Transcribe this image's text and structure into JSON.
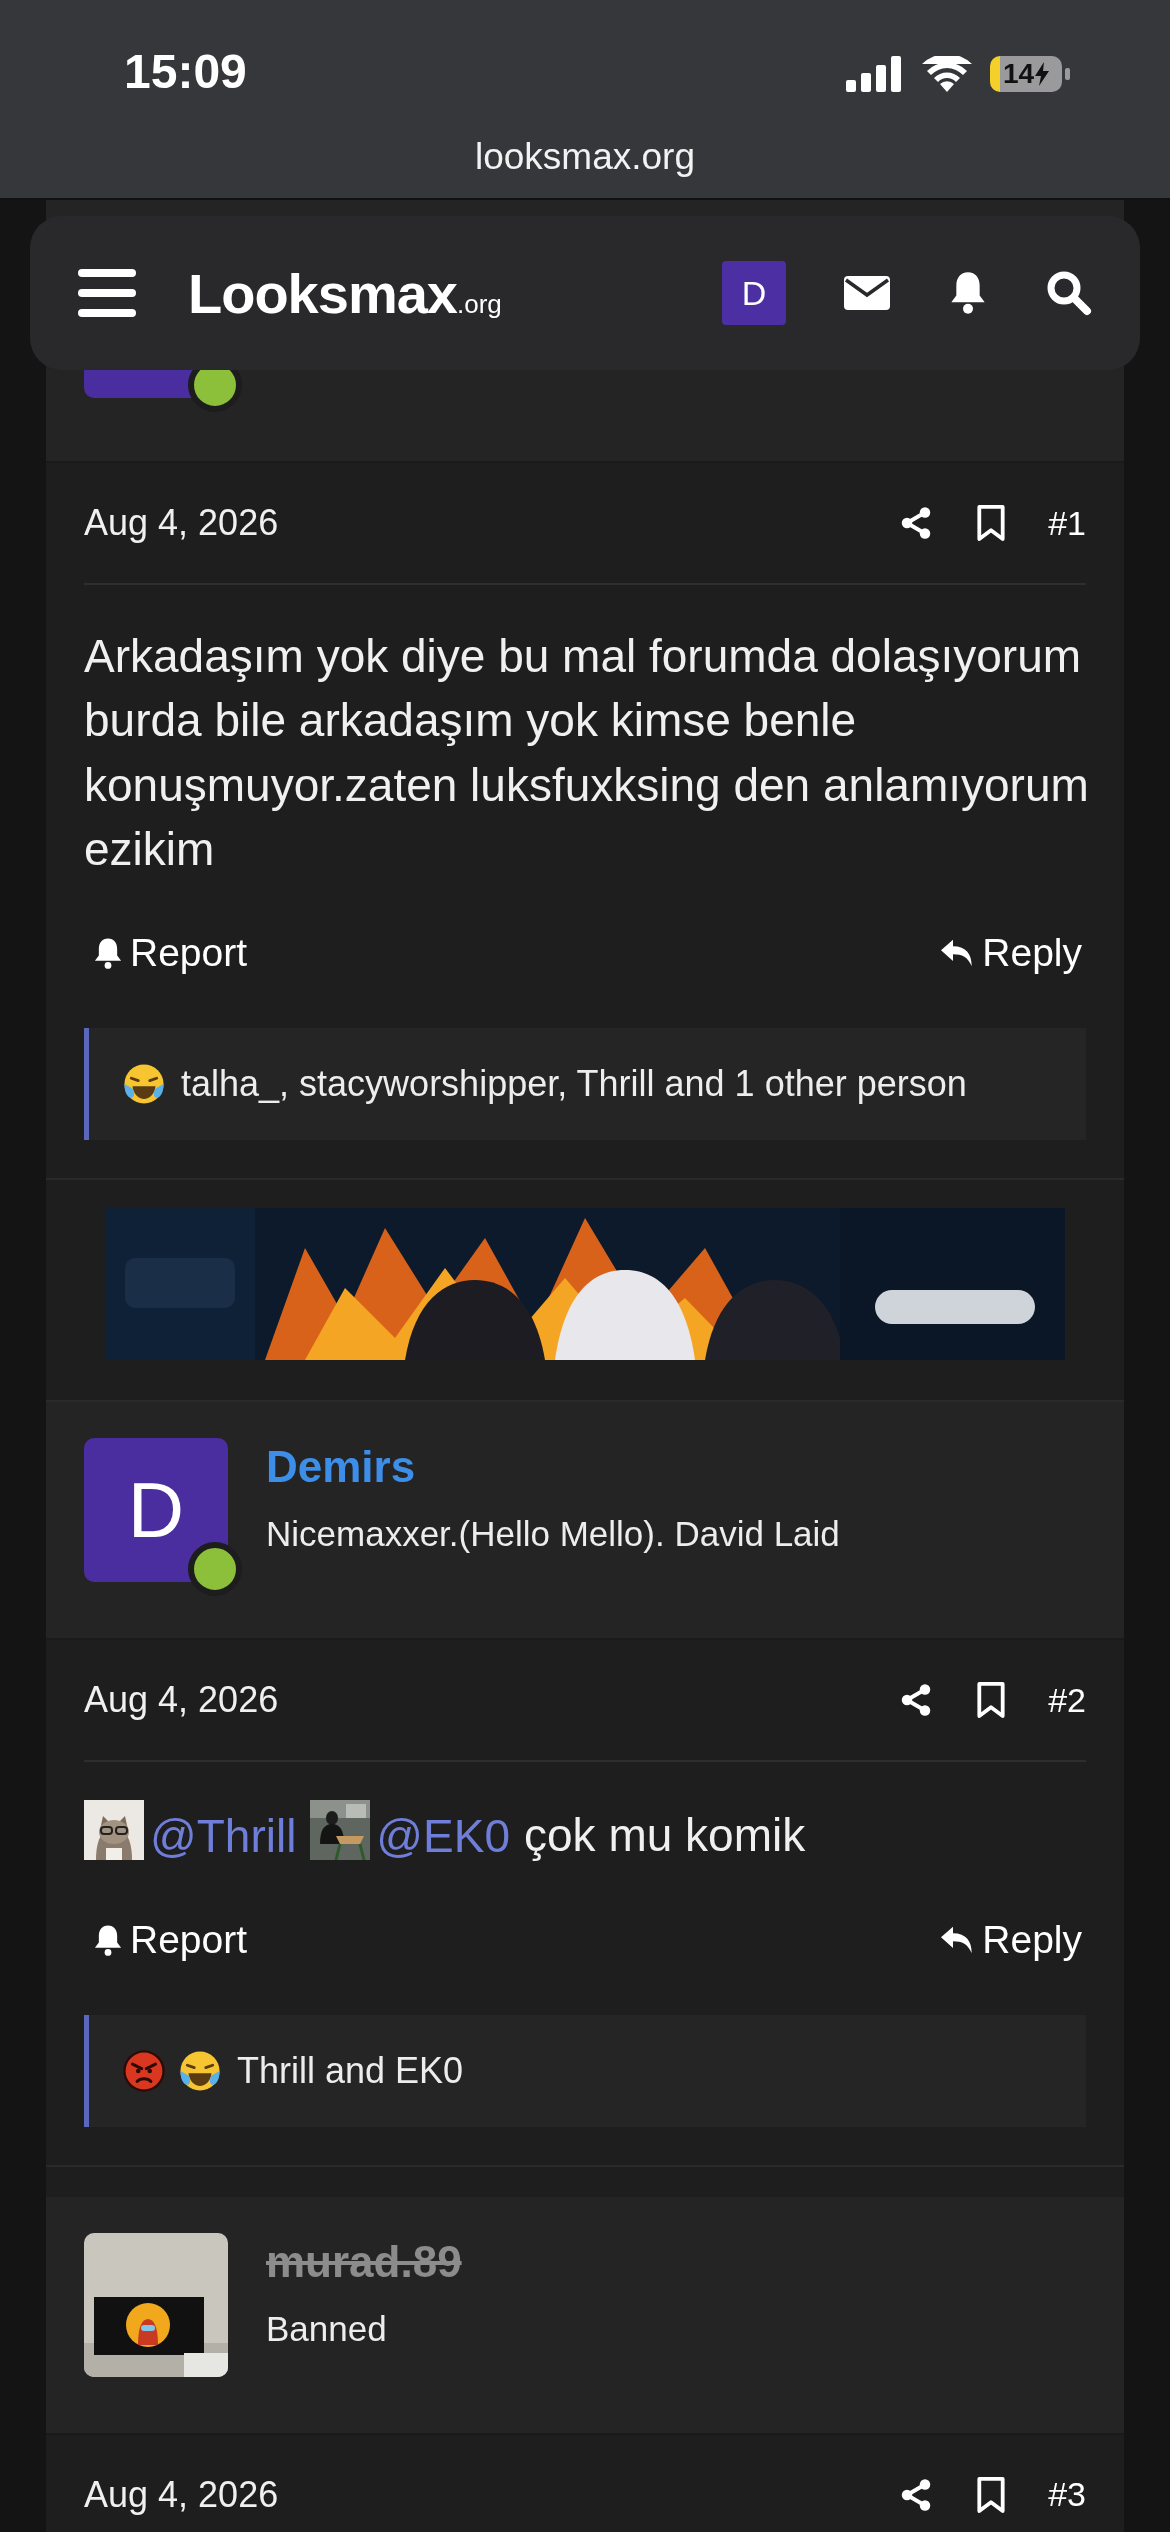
{
  "status_bar": {
    "time": "15:09",
    "battery": "14",
    "url": "looksmax.org"
  },
  "header": {
    "logo": "Looksmax",
    "logo_suffix": ".org",
    "account_letter": "D"
  },
  "posts": [
    {
      "author": {
        "avatar": {
          "kind": "letter"
        },
        "online": true
      },
      "date": "Aug 4, 2026",
      "number": "#1",
      "body": [
        {
          "kind": "text",
          "text": "Arkadaşım yok diye bu mal forumda dolaşıyorum burda bile arkadaşım yok kimse benle konuşmuyor.zaten luksfuxksing den anlamıyorum ezikim"
        }
      ],
      "actions": {
        "report": "Report",
        "reply": "Reply"
      },
      "reactions": {
        "emojis": [
          {
            "kind": "laugh"
          }
        ],
        "text": "talha_, stacyworshipper, Thrill and 1 other person"
      }
    },
    {
      "author": {
        "avatar": {
          "kind": "letter",
          "letter": "D"
        },
        "online": true,
        "name": "Demirs",
        "banned": false,
        "title": "Nicemaxxer.(Hello Mello). David Laid"
      },
      "date": "Aug 4, 2026",
      "number": "#2",
      "body": [
        {
          "kind": "avatar"
        },
        {
          "kind": "mention",
          "text": "@Thrill"
        },
        {
          "kind": "avatar"
        },
        {
          "kind": "mention",
          "text": "@EK0"
        },
        {
          "kind": "text",
          "text": "çok mu komik"
        }
      ],
      "actions": {
        "report": "Report",
        "reply": "Reply"
      },
      "reactions": {
        "emojis": [
          {
            "kind": "angry"
          },
          {
            "kind": "laugh"
          }
        ],
        "text": "Thrill and EK0"
      }
    },
    {
      "author": {
        "online": false,
        "name": "murad.89",
        "banned": true,
        "title": "Banned"
      },
      "date": "Aug 4, 2026",
      "number": "#3"
    }
  ]
}
